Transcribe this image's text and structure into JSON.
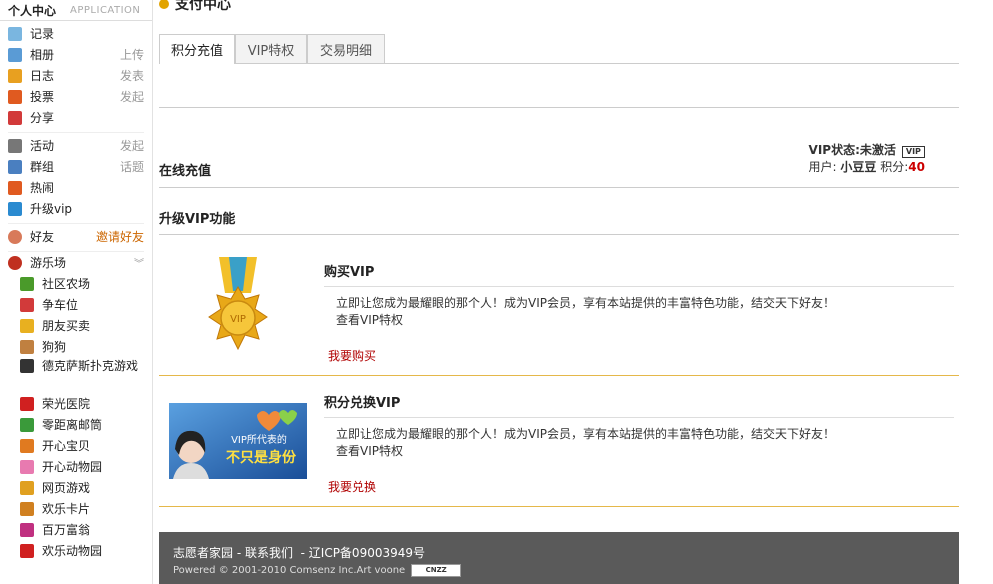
{
  "sidebar": {
    "title": "个人中心",
    "subtitle": "APPLICATION",
    "group1": [
      {
        "label": "记录",
        "action": "",
        "color": "#7ab6e0"
      },
      {
        "label": "相册",
        "action": "上传",
        "color": "#5a9bd5"
      },
      {
        "label": "日志",
        "action": "发表",
        "color": "#e8a020"
      },
      {
        "label": "投票",
        "action": "发起",
        "color": "#e05a20"
      },
      {
        "label": "分享",
        "action": "",
        "color": "#d23a3a"
      }
    ],
    "group2": [
      {
        "label": "活动",
        "action": "发起",
        "color": "#777777"
      },
      {
        "label": "群组",
        "action": "话题",
        "color": "#4a7fc0"
      },
      {
        "label": "热闹",
        "action": "",
        "color": "#e05a20"
      },
      {
        "label": "升级vip",
        "action": "",
        "color": "#2a8ad0"
      }
    ],
    "friends": {
      "label": "好友",
      "action": "邀请好友"
    },
    "playground": {
      "label": "游乐场"
    },
    "apps": [
      {
        "label": "社区农场",
        "color": "#4a9a2a"
      },
      {
        "label": "争车位",
        "color": "#d23a3a"
      },
      {
        "label": "朋友买卖",
        "color": "#e8b020"
      },
      {
        "label": "狗狗",
        "color": "#c08040"
      },
      {
        "label": "德克萨斯扑克游戏",
        "color": "#333333"
      },
      {
        "label": "荣光医院",
        "color": "#d02020"
      },
      {
        "label": "零距离邮筒",
        "color": "#3a9a3a"
      },
      {
        "label": "开心宝贝",
        "color": "#e07a20"
      },
      {
        "label": "开心动物园",
        "color": "#e87ab0"
      },
      {
        "label": "网页游戏",
        "color": "#e0a020"
      },
      {
        "label": "欢乐卡片",
        "color": "#d08020"
      },
      {
        "label": "百万富翁",
        "color": "#c03080"
      },
      {
        "label": "欢乐动物园",
        "color": "#d02020"
      }
    ]
  },
  "main": {
    "page_title": "支付中心",
    "tabs": [
      "积分充值",
      "VIP特权",
      "交易明细"
    ],
    "online_recharge": "在线充值",
    "vip_status_label": "VIP状态:未激活",
    "vip_badge": "VIP",
    "user_label": "用户:",
    "user_name": "小豆豆",
    "score_label": "积分:",
    "score_value": "40",
    "upgrade_title": "升级VIP功能",
    "features": [
      {
        "title": "购买VIP",
        "desc": "立即让您成为最耀眼的那个人！成为VIP会员，享有本站提供的丰富特色功能，结交天下好友！",
        "view": "查看VIP特权",
        "link": "我要购买",
        "medal_text": "VIP"
      },
      {
        "title": "积分兑换VIP",
        "desc": "立即让您成为最耀眼的那个人！成为VIP会员，享有本站提供的丰富特色功能，结交天下好友！",
        "view": "查看VIP特权",
        "link": "我要兑换",
        "banner_line1": "VIP所代表的",
        "banner_line2": "不只是身份"
      }
    ]
  },
  "footer": {
    "site": "志愿者家园",
    "contact": "联系我们",
    "icp": "辽ICP备09003949号",
    "powered": "Powered © 2001-2010 Comsenz Inc.Art voone",
    "cnzz": "CNZZ"
  }
}
